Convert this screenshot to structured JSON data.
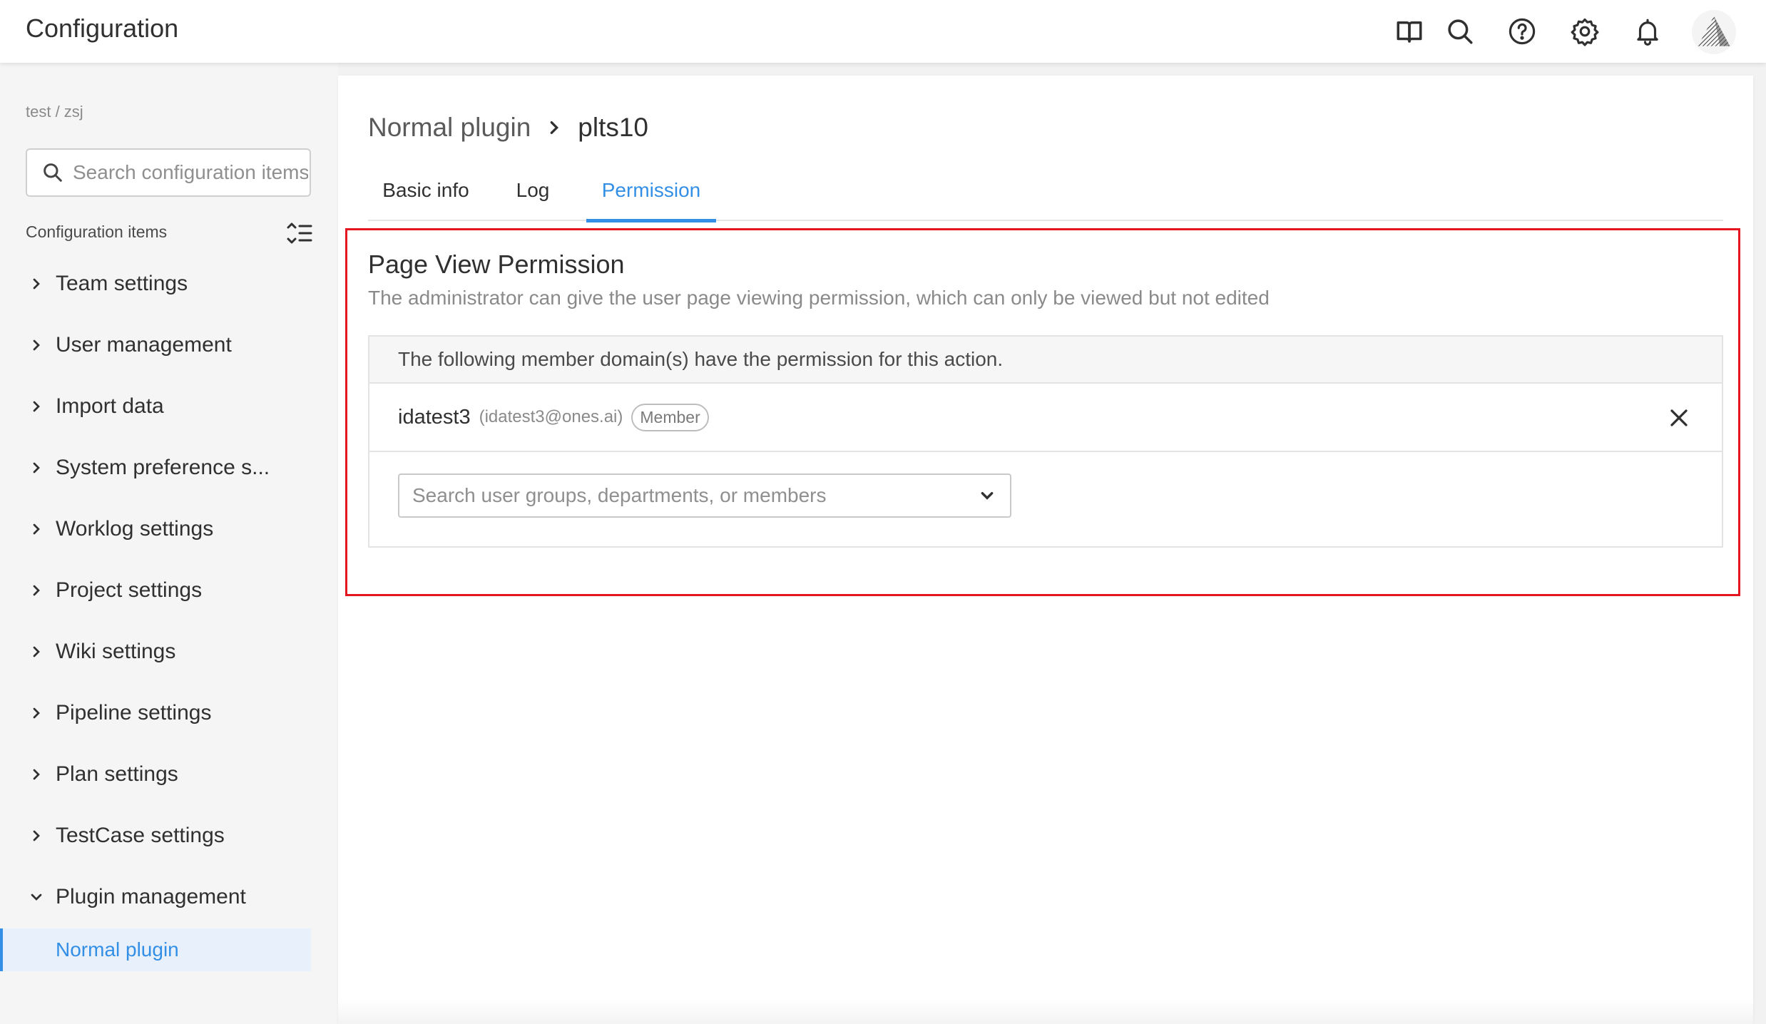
{
  "header": {
    "title": "Configuration",
    "icons": [
      "book-icon",
      "search-icon",
      "help-icon",
      "settings-icon",
      "bell-icon",
      "avatar"
    ]
  },
  "sidebar": {
    "breadcrumb": "test / zsj",
    "search_placeholder": "Search configuration items",
    "section_label": "Configuration items",
    "items": [
      {
        "label": "Team settings",
        "expanded": false
      },
      {
        "label": "User management",
        "expanded": false
      },
      {
        "label": "Import data",
        "expanded": false
      },
      {
        "label": "System preference s...",
        "expanded": false
      },
      {
        "label": "Worklog settings",
        "expanded": false
      },
      {
        "label": "Project settings",
        "expanded": false
      },
      {
        "label": "Wiki settings",
        "expanded": false
      },
      {
        "label": "Pipeline settings",
        "expanded": false
      },
      {
        "label": "Plan settings",
        "expanded": false
      },
      {
        "label": "TestCase settings",
        "expanded": false
      },
      {
        "label": "Plugin management",
        "expanded": true
      }
    ],
    "sub_item": {
      "label": "Normal plugin",
      "selected": true
    }
  },
  "main": {
    "breadcrumb": {
      "parent": "Normal plugin",
      "current": "plts10"
    },
    "tabs": [
      {
        "label": "Basic info",
        "active": false
      },
      {
        "label": "Log",
        "active": false
      },
      {
        "label": "Permission",
        "active": true
      }
    ],
    "permission": {
      "title": "Page View Permission",
      "description": "The administrator can give the user page viewing permission, which can only be viewed but not edited",
      "table_header": "The following member domain(s) have the permission for this action.",
      "member": {
        "name": "idatest3",
        "email": "(idatest3@ones.ai)",
        "badge": "Member"
      },
      "select_placeholder": "Search user groups, departments, or members"
    }
  },
  "colors": {
    "accent": "#338fe5",
    "highlight": "#e4161f",
    "selected_bg": "#e8f1fb"
  }
}
